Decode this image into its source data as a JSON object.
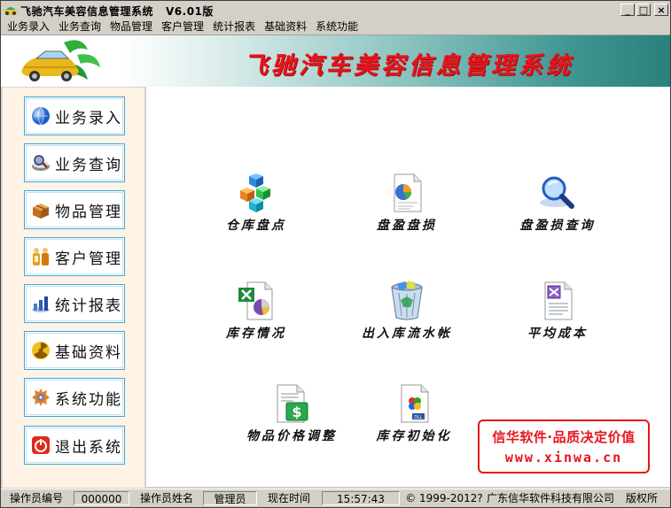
{
  "window": {
    "title": "飞驰汽车美容信息管理系统",
    "version": "V6.01版",
    "buttons": {
      "minimize": "_",
      "maximize": "□",
      "close": "×"
    }
  },
  "menu": [
    "业务录入",
    "业务查询",
    "物品管理",
    "客户管理",
    "统计报表",
    "基础资料",
    "系统功能"
  ],
  "banner": {
    "title": "飞驰汽车美容信息管理系统"
  },
  "nav": [
    {
      "label": "业务录入",
      "icon": "globe-icon"
    },
    {
      "label": "业务查询",
      "icon": "search-bowl-icon"
    },
    {
      "label": "物品管理",
      "icon": "box-icon"
    },
    {
      "label": "客户管理",
      "icon": "customers-icon"
    },
    {
      "label": "统计报表",
      "icon": "chart-icon"
    },
    {
      "label": "基础资料",
      "icon": "radiation-icon"
    },
    {
      "label": "系统功能",
      "icon": "gear-icon"
    },
    {
      "label": "退出系统",
      "icon": "power-icon"
    }
  ],
  "items": [
    {
      "label": "仓库盘点",
      "icon": "cubes-icon"
    },
    {
      "label": "盘盈盘损",
      "icon": "pie-document-icon"
    },
    {
      "label": "盘盈损查询",
      "icon": "magnifier-icon"
    },
    {
      "label": "库存情况",
      "icon": "excel-chart-icon"
    },
    {
      "label": "出入库流水帐",
      "icon": "recycle-bin-icon"
    },
    {
      "label": "平均成本",
      "icon": "document-icon"
    },
    {
      "label": "物品价格调整",
      "icon": "money-document-icon"
    },
    {
      "label": "库存初始化",
      "icon": "dll-file-icon"
    }
  ],
  "promo": {
    "line1": "信华软件·品质决定价值",
    "line2": "www.xinwa.cn"
  },
  "status": {
    "operator_no_label": "操作员编号",
    "operator_no": "000000",
    "operator_name_label": "操作员姓名",
    "operator_name": "管理员",
    "time_label": "现在时间",
    "time": "15:57:43",
    "copyright": "© 1999-2012?",
    "company": "广东信华软件科技有限公司",
    "rights": "版权所"
  }
}
